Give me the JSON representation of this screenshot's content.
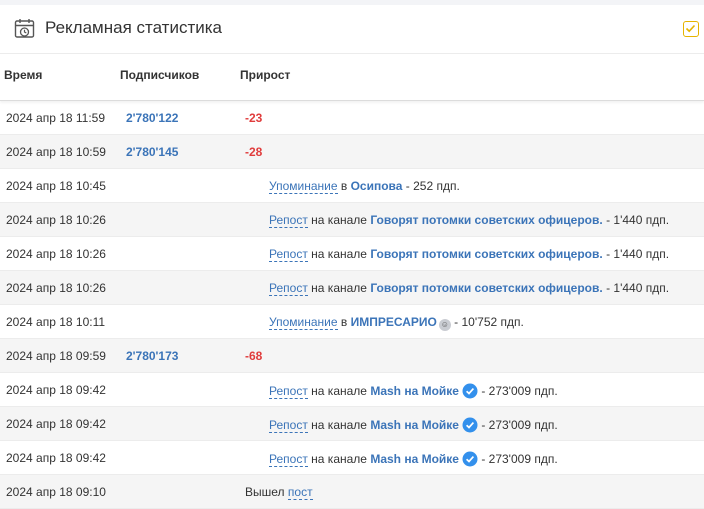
{
  "header": {
    "title": "Рекламная статистика"
  },
  "columns": {
    "time": "Время",
    "subs": "Подписчиков",
    "growth": "Прирост"
  },
  "rows": [
    {
      "time": "2024 апр 18 11:59",
      "subs": "2'780'122",
      "growth": "-23"
    },
    {
      "time": "2024 апр 18 10:59",
      "subs": "2'780'145",
      "growth": "-28"
    },
    {
      "time": "2024 апр 18 10:45",
      "link": "Упоминание",
      "mid": "в",
      "channel": "Осипова",
      "tail": "- 252 пдп."
    },
    {
      "time": "2024 апр 18 10:26",
      "link": "Репост",
      "mid": "на канале",
      "channel": "Говорят потомки советских офицеров.",
      "tail": "- 1'440 пдп."
    },
    {
      "time": "2024 апр 18 10:26",
      "link": "Репост",
      "mid": "на канале",
      "channel": "Говорят потомки советских офицеров.",
      "tail": "- 1'440 пдп."
    },
    {
      "time": "2024 апр 18 10:26",
      "link": "Репост",
      "mid": "на канале",
      "channel": "Говорят потомки советских офицеров.",
      "tail": "- 1'440 пдп."
    },
    {
      "time": "2024 апр 18 10:11",
      "link": "Упоминание",
      "mid": "в",
      "channel": "ИМПРЕСАРИО",
      "tail": "- 10'752 пдп."
    },
    {
      "time": "2024 апр 18 09:59",
      "subs": "2'780'173",
      "growth": "-68"
    },
    {
      "time": "2024 апр 18 09:42",
      "link": "Репост",
      "mid": "на канале",
      "channel": "Mash на Мойке",
      "tail": "- 273'009 пдп."
    },
    {
      "time": "2024 апр 18 09:42",
      "link": "Репост",
      "mid": "на канале",
      "channel": "Mash на Мойке",
      "tail": "- 273'009 пдп."
    },
    {
      "time": "2024 апр 18 09:42",
      "link": "Репост",
      "mid": "на канале",
      "channel": "Mash на Мойке",
      "tail": "- 273'009 пдп."
    },
    {
      "time": "2024 апр 18 09:10",
      "pre": "Вышел",
      "link": "пост"
    }
  ]
}
